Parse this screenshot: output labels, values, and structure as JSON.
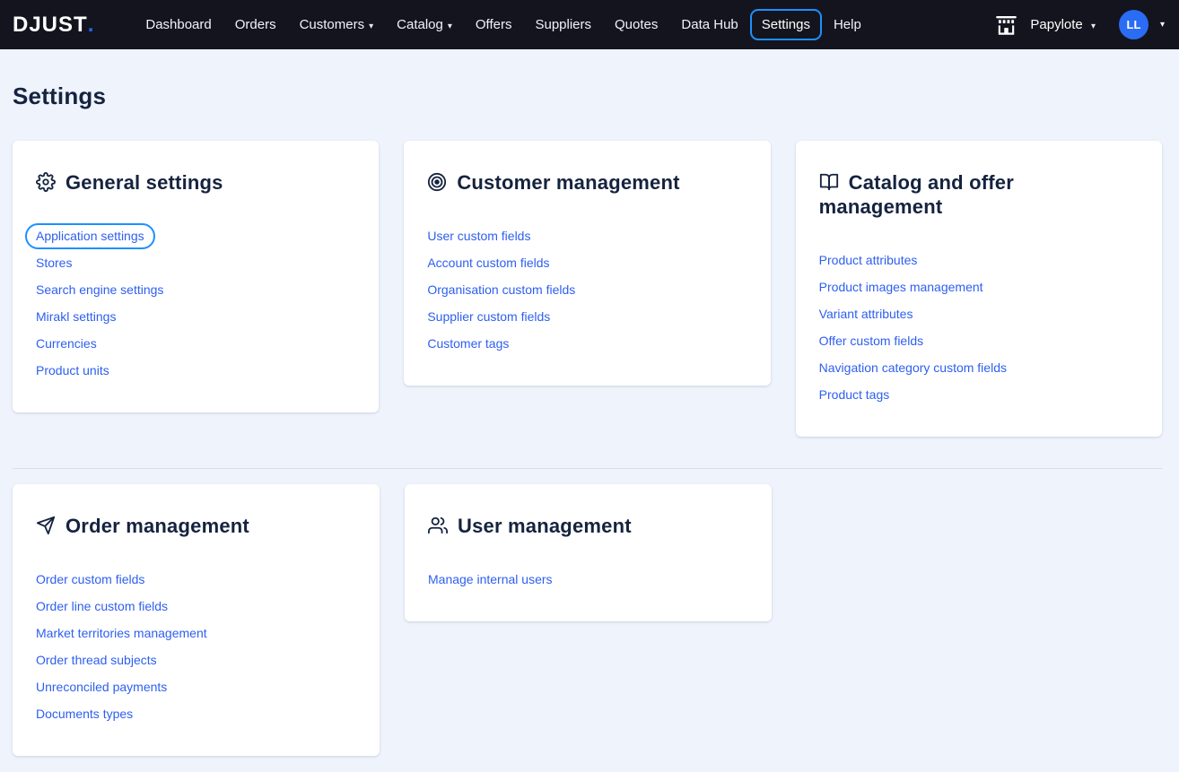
{
  "colors": {
    "nav-bg": "#14141e",
    "page-bg": "#eef3fc",
    "heading": "#15233f",
    "link": "#2d5ff0",
    "focus-ring": "#1e90ff",
    "avatar-bg": "#2b6cf4",
    "logo-dot": "#1a6dff"
  },
  "nav": {
    "logo_text": "DJUST",
    "logo_dot": ".",
    "caret_glyph": "▾",
    "items": [
      {
        "label": "Dashboard"
      },
      {
        "label": "Orders"
      },
      {
        "label": "Customers"
      },
      {
        "label": "Catalog"
      },
      {
        "label": "Offers"
      },
      {
        "label": "Suppliers"
      },
      {
        "label": "Quotes"
      },
      {
        "label": "Data Hub"
      },
      {
        "label": "Settings"
      },
      {
        "label": "Help"
      }
    ],
    "workspace_name": "Papylote",
    "avatar_initials": "LL"
  },
  "page": {
    "title": "Settings"
  },
  "cards": [
    {
      "title": "General settings",
      "icon": "gear-icon",
      "links": [
        "Application settings",
        "Stores",
        "Search engine settings",
        "Mirakl settings",
        "Currencies",
        "Product units"
      ]
    },
    {
      "title": "Customer management",
      "icon": "target-icon",
      "links": [
        "User custom fields",
        "Account custom fields",
        "Organisation custom fields",
        "Supplier custom fields",
        "Customer tags"
      ]
    },
    {
      "title": "Catalog and offer management",
      "icon": "book-open-icon",
      "links": [
        "Product attributes",
        "Product images management",
        "Variant attributes",
        "Offer custom fields",
        "Navigation category custom fields",
        "Product tags"
      ]
    },
    {
      "title": "Order management",
      "icon": "send-icon",
      "links": [
        "Order custom fields",
        "Order line custom fields",
        "Market territories management",
        "Order thread subjects",
        "Unreconciled payments",
        "Documents types"
      ]
    },
    {
      "title": "User management",
      "icon": "users-icon",
      "links": [
        "Manage internal users"
      ]
    }
  ]
}
